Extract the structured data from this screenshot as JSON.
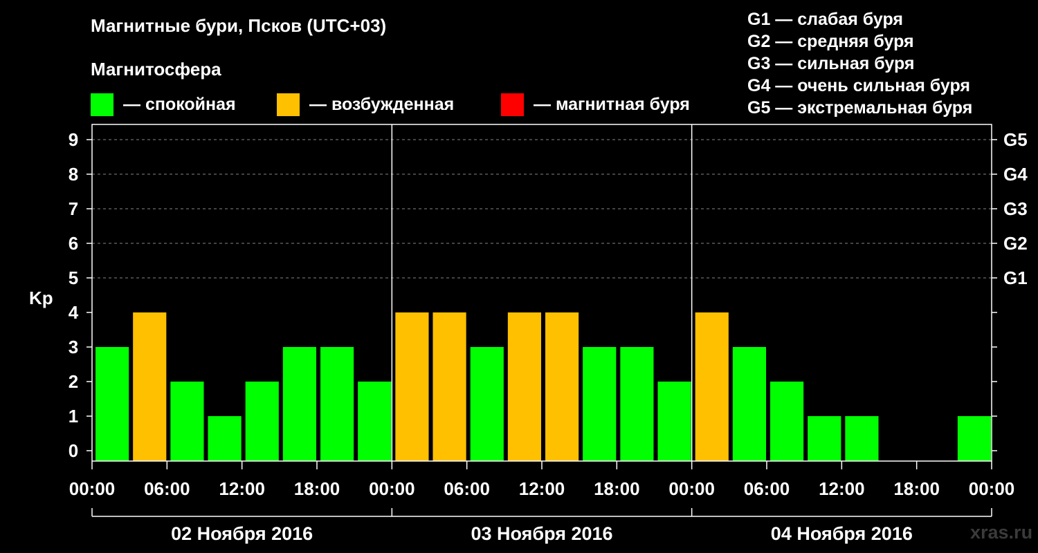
{
  "chart_data": {
    "type": "bar",
    "title": "Магнитные бури, Псков (UTC+03)",
    "subtitle": "Магнитосфера",
    "ylabel": "Kp",
    "ylim": [
      0,
      9
    ],
    "yticks": [
      "0",
      "1",
      "2",
      "3",
      "4",
      "5",
      "6",
      "7",
      "8",
      "9"
    ],
    "right_axis_labels": [
      {
        "kp": 5,
        "label": "G1"
      },
      {
        "kp": 6,
        "label": "G2"
      },
      {
        "kp": 7,
        "label": "G3"
      },
      {
        "kp": 8,
        "label": "G4"
      },
      {
        "kp": 9,
        "label": "G5"
      }
    ],
    "xtick_labels": [
      "00:00",
      "06:00",
      "12:00",
      "18:00",
      "00:00",
      "06:00",
      "12:00",
      "18:00",
      "00:00",
      "06:00",
      "12:00",
      "18:00",
      "00:00"
    ],
    "days": [
      "02 Ноября 2016",
      "03 Ноября 2016",
      "04 Ноября 2016"
    ],
    "interval_hours": 3,
    "values": [
      3,
      4,
      2,
      1,
      2,
      3,
      3,
      2,
      4,
      4,
      3,
      4,
      4,
      3,
      3,
      2,
      4,
      3,
      2,
      1,
      1,
      0,
      0,
      1
    ],
    "categories": [
      "calm",
      "excited",
      "storm"
    ],
    "category_of_value": {
      "calm_max": 3,
      "excited_max": 4
    },
    "grid": "dashed horizontal at Kp 5-9",
    "legend": [
      {
        "label": "— спокойная",
        "color": "#00ff00"
      },
      {
        "label": "— возбужденная",
        "color": "#ffc000"
      },
      {
        "label": "— магнитная буря",
        "color": "#ff0000"
      }
    ],
    "storm_levels": [
      "G1 — слабая буря",
      "G2 — средняя буря",
      "G3 — сильная буря",
      "G4 — очень сильная буря",
      "G5 — экстремальная буря"
    ]
  },
  "colors": {
    "calm": "#00ff00",
    "excited": "#ffc000",
    "storm": "#ff0000"
  },
  "watermark": "xras.ru"
}
